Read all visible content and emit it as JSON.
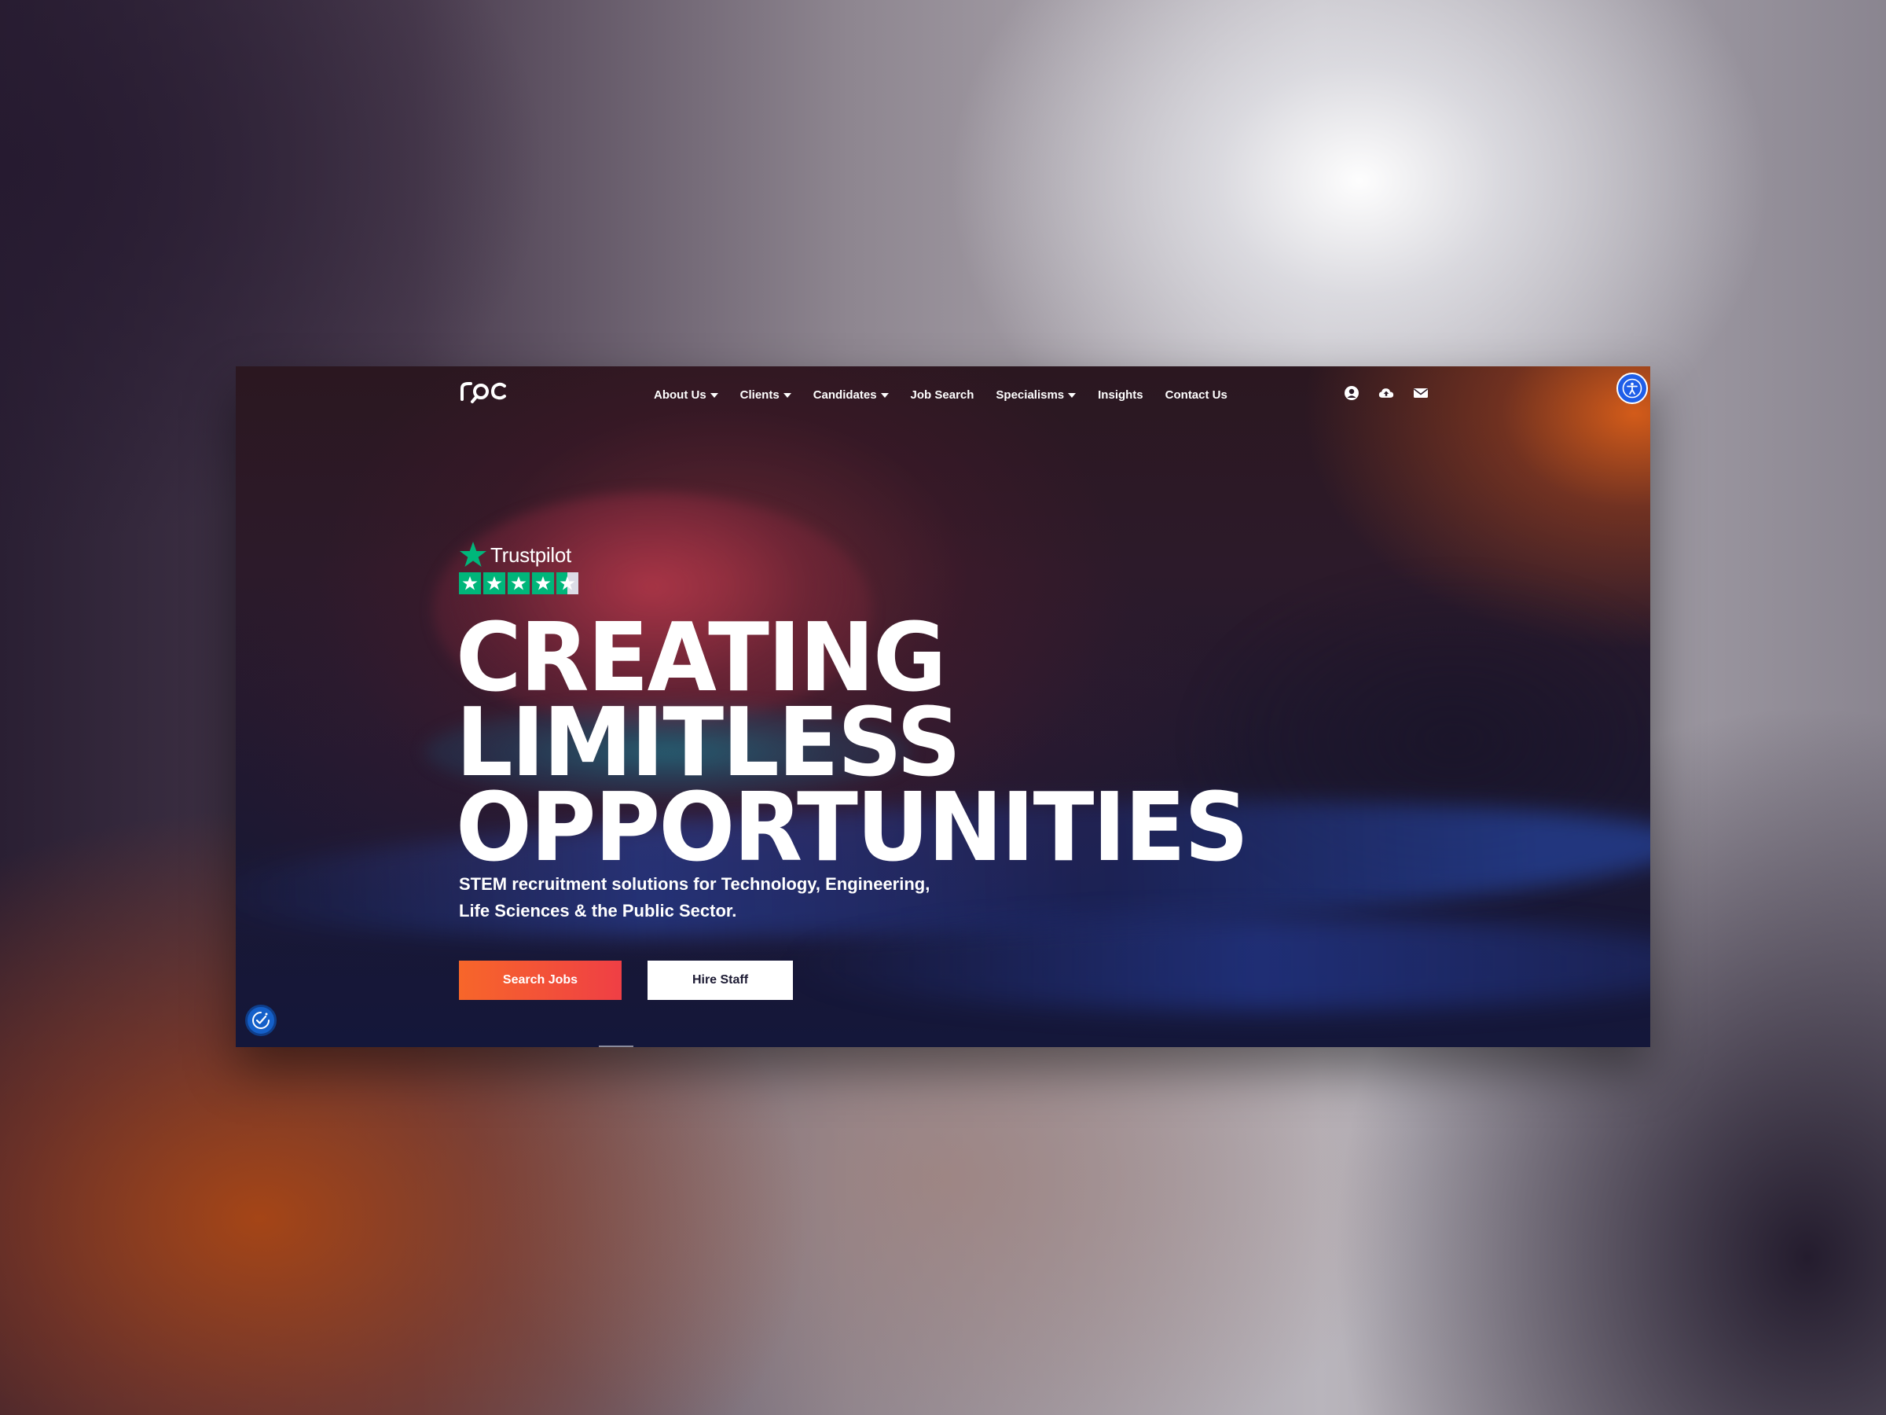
{
  "header": {
    "logo_text": "roc",
    "nav": [
      {
        "label": "About Us",
        "has_dropdown": true
      },
      {
        "label": "Clients",
        "has_dropdown": true
      },
      {
        "label": "Candidates",
        "has_dropdown": true
      },
      {
        "label": "Job Search",
        "has_dropdown": false
      },
      {
        "label": "Specialisms",
        "has_dropdown": true
      },
      {
        "label": "Insights",
        "has_dropdown": false
      },
      {
        "label": "Contact Us",
        "has_dropdown": false
      }
    ],
    "icons": [
      "user-circle-icon",
      "cloud-upload-icon",
      "envelope-icon"
    ]
  },
  "accessibility_button": {
    "icon": "accessibility-person-icon"
  },
  "hero": {
    "trustpilot": {
      "label": "Trustpilot",
      "rating": 4.5,
      "max_rating": 5
    },
    "headline": [
      "CREATING",
      "LIMITLESS",
      "OPPORTUNITIES"
    ],
    "subtitle_line1": "STEM recruitment solutions for Technology, Engineering,",
    "subtitle_line2": "Life Sciences & the Public Sector.",
    "buttons": {
      "search_jobs": "Search Jobs",
      "hire_staff": "Hire Staff"
    }
  },
  "cookie_button": {
    "icon": "cookie-consent-icon"
  },
  "colors": {
    "accent_orange": "#f7662a",
    "accent_red": "#ef3f45",
    "trustpilot_green": "#00b67a",
    "accessibility_blue": "#1f5ee8"
  }
}
